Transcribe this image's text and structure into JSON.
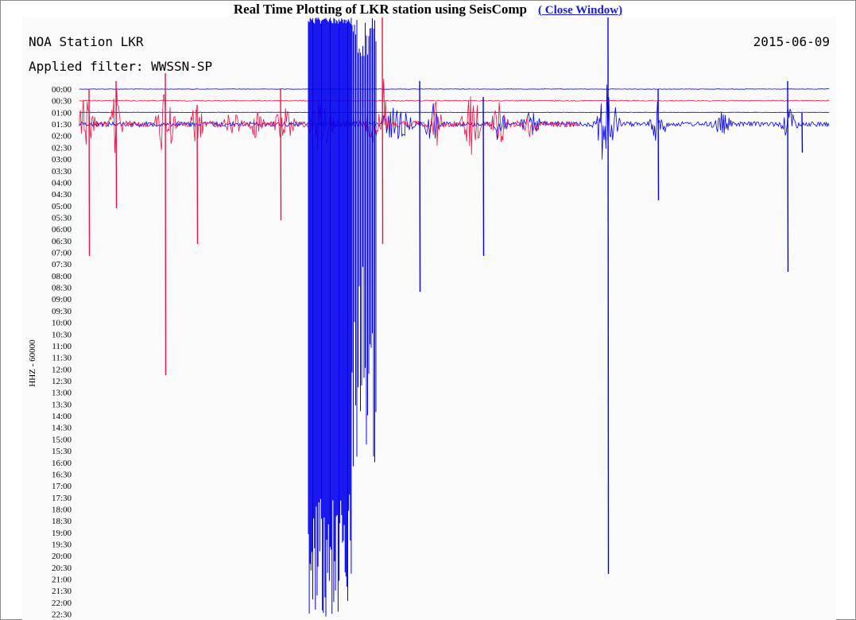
{
  "header": {
    "title": "Real Time Plotting of LKR station using SeisComp",
    "close_open": "(",
    "close_label": "Close Window)"
  },
  "plot": {
    "station_label": "NOA Station LKR",
    "date": "2015-06-09",
    "filter_label": "Applied filter: WWSSN-SP",
    "channel_label": "HHZ - 60000",
    "colors": {
      "line_a": "#0000ee",
      "line_b": "#ee1144",
      "background": "#fafafa"
    }
  },
  "chart_data": {
    "type": "line",
    "title": "NOA Station LKR",
    "ylabel": "HHZ - 60000",
    "tick_labels": [
      "00:00",
      "00:30",
      "01:00",
      "01:30",
      "02:00",
      "02:30",
      "03:00",
      "03:30",
      "04:00",
      "04:30",
      "05:00",
      "05:30",
      "06:00",
      "06:30",
      "07:00",
      "07:30",
      "08:00",
      "08:30",
      "09:00",
      "09:30",
      "10:00",
      "10:30",
      "11:00",
      "11:30",
      "12:00",
      "12:30",
      "13:00",
      "13:30",
      "14:00",
      "14:30",
      "15:00",
      "15:30",
      "16:00",
      "16:30",
      "17:00",
      "17:30",
      "18:00",
      "18:30",
      "19:00",
      "19:30",
      "20:00",
      "20:30",
      "21:00",
      "21:30",
      "22:00",
      "22:30"
    ],
    "series": [
      {
        "color": "#0000ee"
      },
      {
        "color": "#ee1144"
      }
    ],
    "grid": false
  }
}
